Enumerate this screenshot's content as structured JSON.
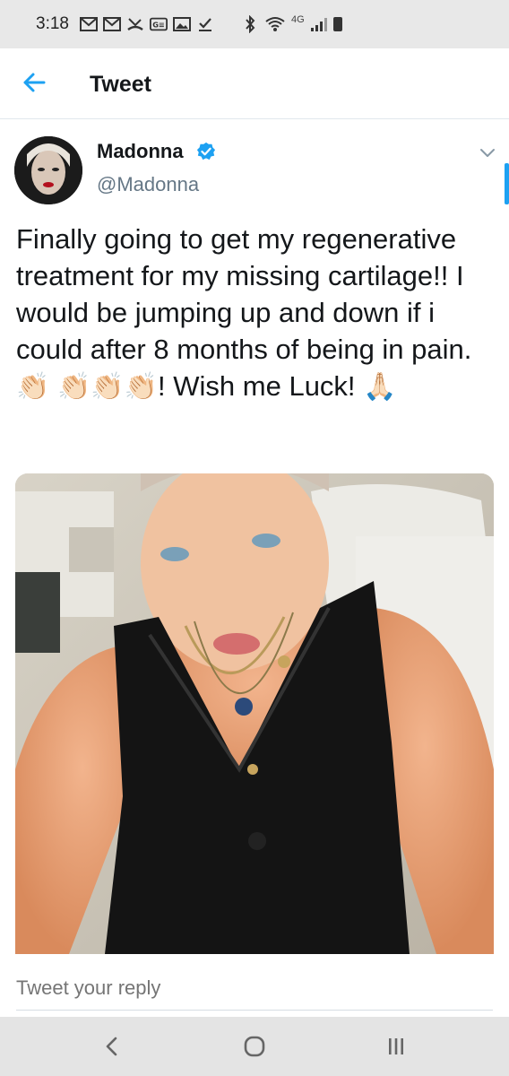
{
  "status_bar": {
    "time": "3:18",
    "network_label": "4G",
    "left_icons": [
      "gmail-icon",
      "gmail-icon",
      "missed-call-icon",
      "ge-icon",
      "gallery-icon",
      "download-done-icon"
    ],
    "right_icons": [
      "bluetooth-icon",
      "wifi-icon",
      "signal-icon",
      "battery-icon"
    ]
  },
  "header": {
    "title": "Tweet",
    "back_icon": "arrow-left-icon",
    "accent_color": "#1da1f2"
  },
  "tweet": {
    "author_name": "Madonna",
    "author_handle": "@Madonna",
    "verified": true,
    "text_main": "Finally going to get my regenerative treatment for my missing cartilage!! I would be jumping up and down if i could after 8 months of being in pain. ",
    "emoji_clap_1": "👏🏻",
    "emoji_claps": "👏🏻👏🏻👏🏻",
    "text_wish": "! Wish me Luck! ",
    "emoji_pray": "🙏🏻",
    "photo_description_icon": "photo-icon"
  },
  "reply": {
    "placeholder": "Tweet your reply"
  },
  "nav": {
    "back_icon": "nav-back-icon",
    "home_icon": "nav-home-icon",
    "recents_icon": "nav-recents-icon"
  }
}
